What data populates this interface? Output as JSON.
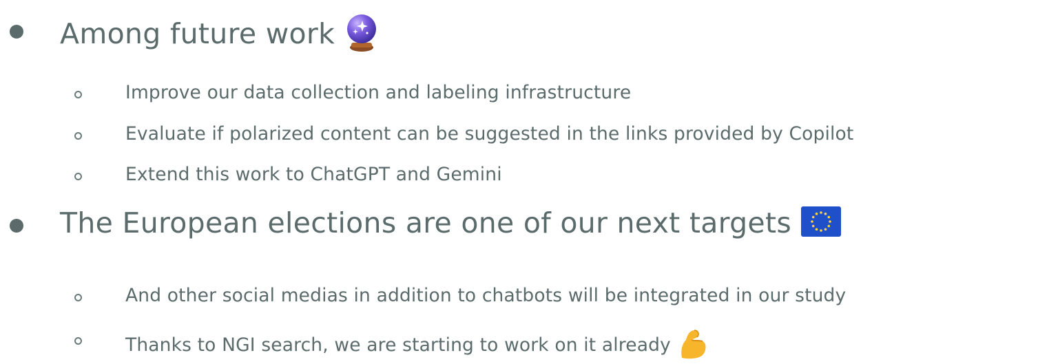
{
  "slide": {
    "items": [
      {
        "text": "Among future work",
        "emoji": "crystal-ball-icon",
        "children": [
          {
            "text": "Improve our data collection and labeling infrastructure"
          },
          {
            "text": "Evaluate if polarized content can be suggested in the links provided by Copilot"
          },
          {
            "text": "Extend this work to ChatGPT and Gemini"
          }
        ]
      },
      {
        "text": "The European elections are one of our next targets",
        "emoji": "eu-flag-icon",
        "children": [
          {
            "text": "And other social medias in addition to chatbots will be integrated in our study"
          },
          {
            "text": "Thanks to NGI search, we are starting to work on it already",
            "emoji": "flexed-biceps-icon"
          }
        ]
      }
    ]
  },
  "colors": {
    "text": "#5b6b6b",
    "eu_blue": "#1f4fc9",
    "eu_star": "#ffd23f"
  }
}
